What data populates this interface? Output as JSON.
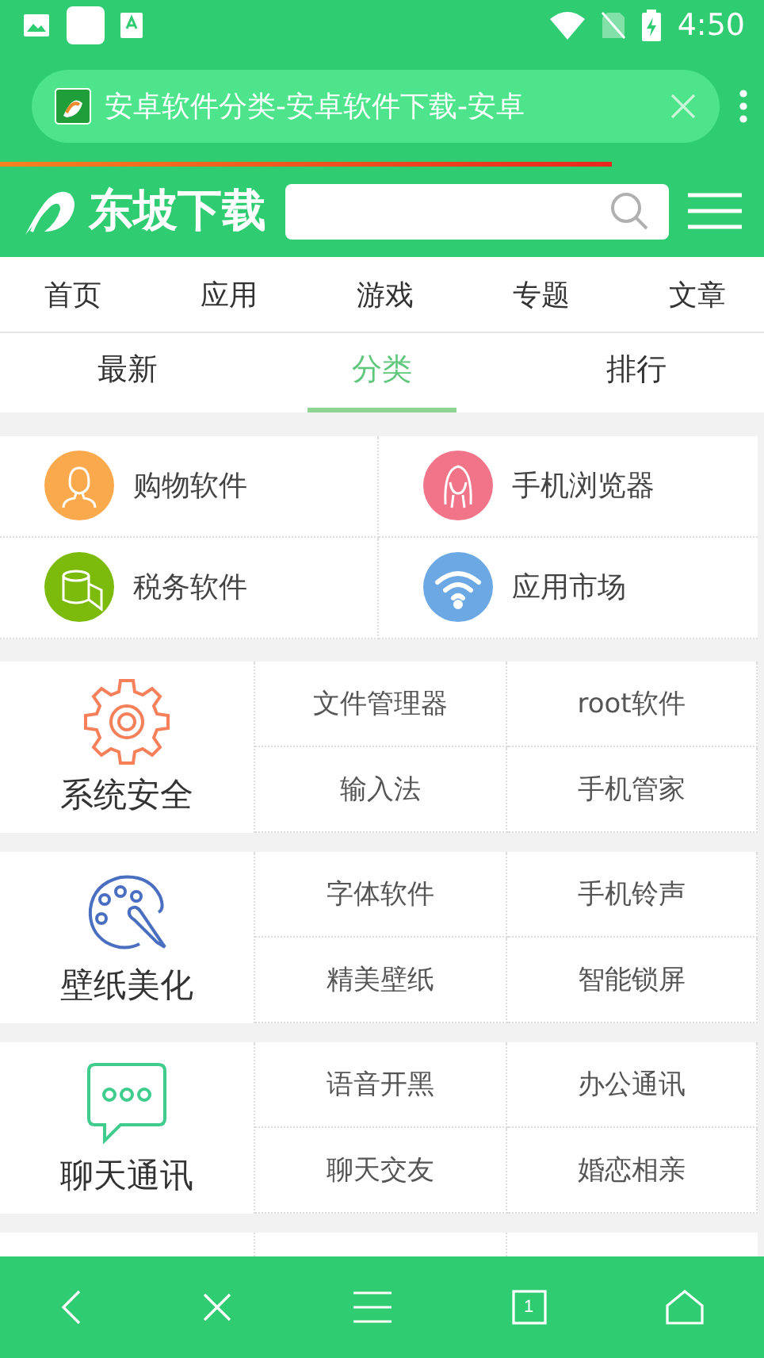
{
  "status_bar": {
    "time": "4:50"
  },
  "browser": {
    "tab_title": "安卓软件分类-安卓软件下载-安卓",
    "page_load": {
      "level": 0.8
    },
    "tab_count": "1"
  },
  "site": {
    "logo_text": "东坡下载"
  },
  "nav": [
    "首页",
    "应用",
    "游戏",
    "专题",
    "文章"
  ],
  "sub_tabs": [
    {
      "label": "最新",
      "selected": false
    },
    {
      "label": "分类",
      "selected": true
    },
    {
      "label": "排行",
      "selected": false
    }
  ],
  "quick_categories": [
    {
      "label": "购物软件",
      "kind": "man",
      "color": "#fba94d"
    },
    {
      "label": "手机浏览器",
      "kind": "woman",
      "color": "#f27489"
    },
    {
      "label": "税务软件",
      "kind": "roll",
      "color": "#7cba0b"
    },
    {
      "label": "应用市场",
      "kind": "wifi",
      "color": "#6ca9e4"
    }
  ],
  "category_groups": [
    {
      "title": "系统安全",
      "kind": "gear",
      "items": [
        "文件管理器",
        "root软件",
        "输入法",
        "手机管家"
      ]
    },
    {
      "title": "壁纸美化",
      "kind": "palette",
      "items": [
        "字体软件",
        "手机铃声",
        "精美壁纸",
        "智能锁屏"
      ]
    },
    {
      "title": "聊天通讯",
      "kind": "chat",
      "items": [
        "语音开黑",
        "办公通讯",
        "聊天交友",
        "婚恋相亲"
      ]
    }
  ]
}
